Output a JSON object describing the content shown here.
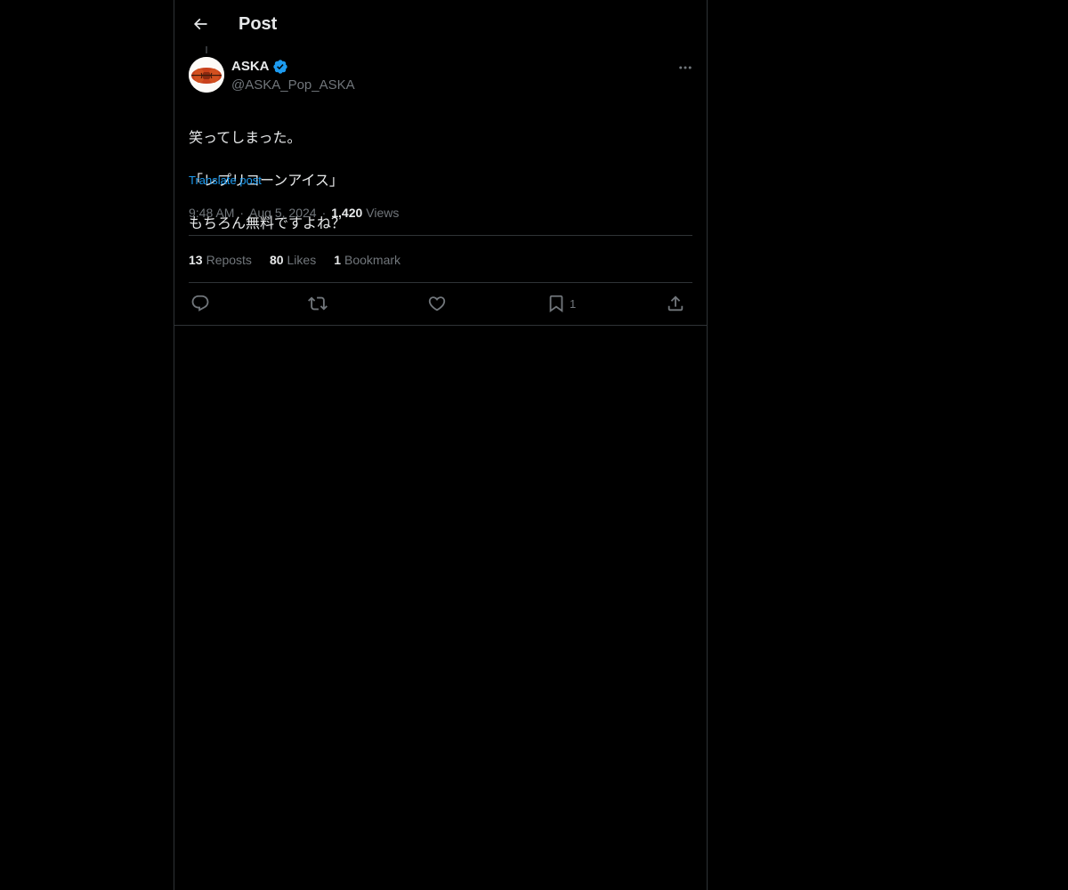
{
  "header": {
    "title": "Post"
  },
  "author": {
    "display_name": "ASKA",
    "handle": "@ASKA_Pop_ASKA",
    "verified": true
  },
  "post": {
    "lines": [
      "笑ってしまった。",
      "「レプリコーンアイス」",
      "もちろん無料ですよね？"
    ],
    "translate_label": "Translate post",
    "time": "9:48 AM",
    "date": "Aug 5, 2024",
    "views_count": "1,420",
    "views_label": "Views"
  },
  "stats": {
    "reposts_count": "13",
    "reposts_label": "Reposts",
    "likes_count": "80",
    "likes_label": "Likes",
    "bookmarks_count": "1",
    "bookmarks_label": "Bookmark"
  },
  "actions": {
    "reply_icon": "reply-icon",
    "repost_icon": "repost-icon",
    "like_icon": "heart-icon",
    "bookmark_icon": "bookmark-icon",
    "bookmark_count": "1",
    "share_icon": "share-icon"
  },
  "colors": {
    "background": "#000000",
    "text": "#e7e9ea",
    "secondary": "#71767b",
    "accent": "#1d9bf0",
    "border": "#2f3336"
  }
}
